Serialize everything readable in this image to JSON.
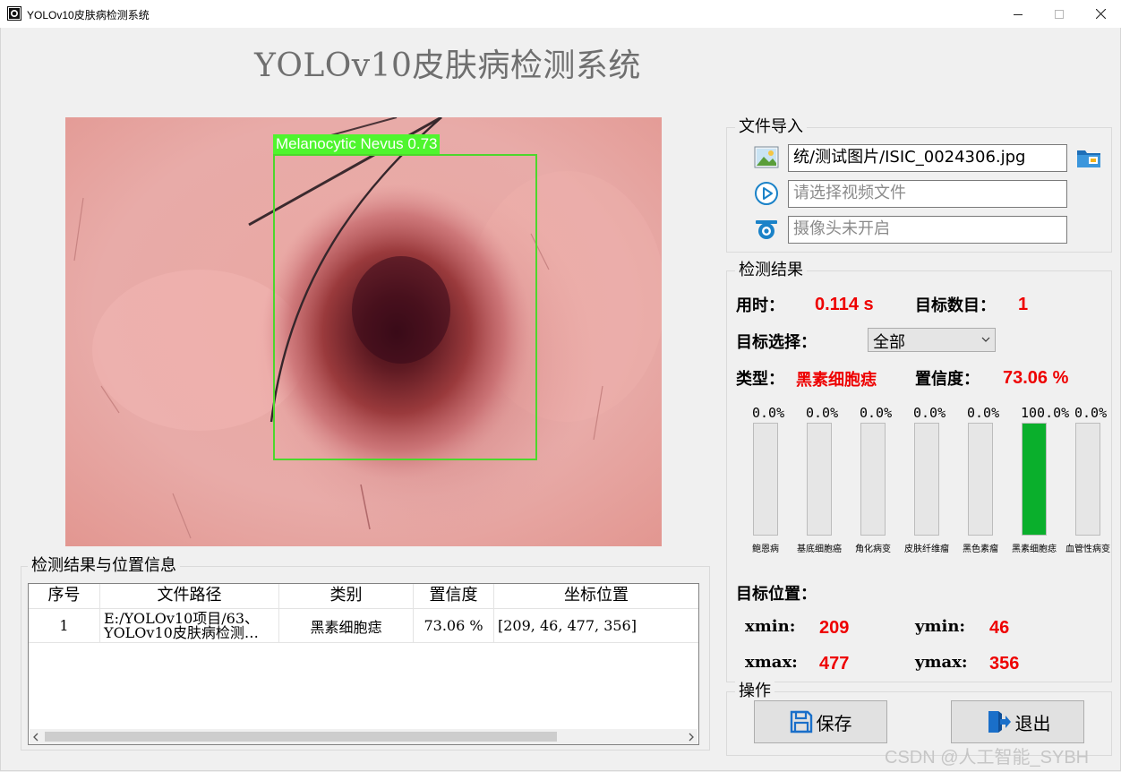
{
  "window": {
    "title": "YOLOv10皮肤病检测系统",
    "minimize_icon": "minimize-icon",
    "maximize_icon": "maximize-icon",
    "close_icon": "close-icon"
  },
  "heading": "YOLOv10皮肤病检测系统",
  "image": {
    "detection_label": "Melanocytic Nevus 0.73",
    "box_color": "#4cd72c"
  },
  "file_import": {
    "title": "文件导入",
    "image_path": "统/测试图片/ISIC_0024306.jpg",
    "video_placeholder": "请选择视频文件",
    "camera_placeholder": "摄像头未开启",
    "icons": [
      "image-icon",
      "folder-icon",
      "play-icon",
      "camera-icon"
    ]
  },
  "results": {
    "title": "检测结果",
    "time_label": "用时：",
    "time_value": "0.114 s",
    "count_label": "目标数目：",
    "count_value": "1",
    "select_label": "目标选择：",
    "select_value": "全部",
    "type_label": "类型：",
    "type_value": "黑素细胞痣",
    "conf_label": "置信度：",
    "conf_value": "73.06 %",
    "bars": [
      {
        "pct_text": "0.0%",
        "value": 0.0,
        "name": "鲍恩病"
      },
      {
        "pct_text": "0.0%",
        "value": 0.0,
        "name": "基底细胞癌"
      },
      {
        "pct_text": "0.0%",
        "value": 0.0,
        "name": "角化病变"
      },
      {
        "pct_text": "0.0%",
        "value": 0.0,
        "name": "皮肤纤维瘤"
      },
      {
        "pct_text": "0.0%",
        "value": 0.0,
        "name": "黑色素瘤"
      },
      {
        "pct_text": "100.0%",
        "value": 100.0,
        "name": "黑素细胞痣"
      },
      {
        "pct_text": "0.0%",
        "value": 0.0,
        "name": "血管性病变"
      }
    ],
    "bar_color": "#0aaf2c",
    "position_label": "目标位置：",
    "xmin_label": "xmin:",
    "xmin": "209",
    "ymin_label": "ymin:",
    "ymin": "46",
    "xmax_label": "xmax:",
    "xmax": "477",
    "ymax_label": "ymax:",
    "ymax": "356"
  },
  "ops": {
    "title": "操作",
    "save_label": "保存",
    "exit_label": "退出"
  },
  "table": {
    "title": "检测结果与位置信息",
    "headers": [
      "序号",
      "文件路径",
      "类别",
      "置信度",
      "坐标位置"
    ],
    "rows": [
      {
        "index": "1",
        "path_line1": "E:/YOLOv10项目/63、",
        "path_line2": "YOLOv10皮肤病检测…",
        "category": "黑素细胞痣",
        "confidence": "73.06 %",
        "coords": "[209, 46, 477, 356]"
      }
    ]
  },
  "watermark": "CSDN @人工智能_SYBH"
}
